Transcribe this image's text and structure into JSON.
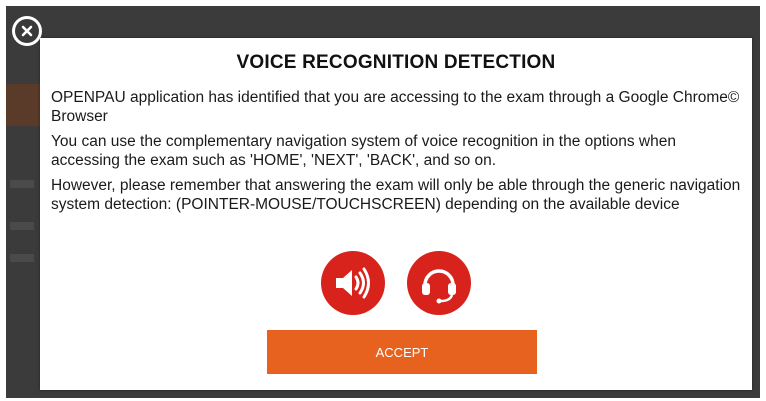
{
  "dialog": {
    "title": "VOICE RECOGNITION DETECTION",
    "paragraphs": [
      "OPENPAU application has identified that you are accessing to the exam through a Google Chrome© Browser",
      "You can use the complementary navigation system of voice recognition in the options when accessing the exam such as 'HOME', 'NEXT', 'BACK', and so on.",
      "However, please remember that answering the exam will only be able through the generic navigation system detection: (POINTER-MOUSE/TOUCHSCREEN) depending on the available device"
    ],
    "accept_label": "ACCEPT",
    "icons": {
      "speaker": "speaker-icon",
      "headset": "headset-icon",
      "close": "close-icon"
    }
  },
  "colors": {
    "accent_red": "#d8231d",
    "accept_orange": "#e8621f",
    "backdrop": "#3b3b3b"
  }
}
